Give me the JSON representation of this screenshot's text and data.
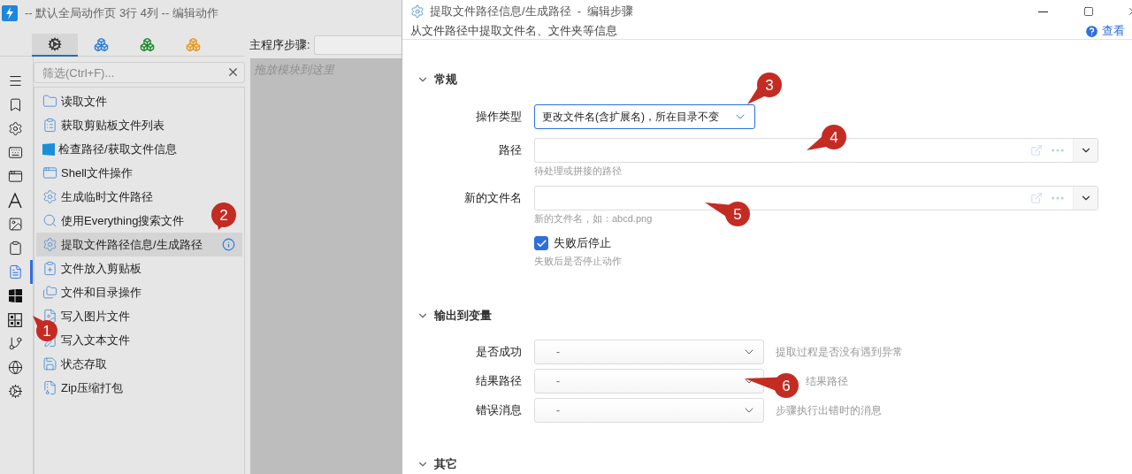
{
  "window": {
    "title": "-- 默认全局动作页 3行 4列 -- 编辑动作"
  },
  "category_tabs": [
    {
      "selected": true,
      "color": "#333333"
    },
    {
      "selected": false,
      "color": "#2f80d8"
    },
    {
      "selected": false,
      "color": "#1f8a2e"
    },
    {
      "selected": false,
      "color": "#e8981c"
    }
  ],
  "filter": {
    "placeholder": "筛选(Ctrl+F)..."
  },
  "rail": [
    {
      "selected": false
    },
    {
      "selected": false
    },
    {
      "selected": false
    },
    {
      "selected": false
    },
    {
      "selected": false
    },
    {
      "selected": false
    },
    {
      "selected": false
    },
    {
      "selected": false
    },
    {
      "selected": true
    },
    {
      "selected": false
    },
    {
      "selected": false
    },
    {
      "selected": false
    },
    {
      "selected": false
    },
    {
      "selected": false
    }
  ],
  "modules": [
    {
      "label": "读取文件",
      "selected": false
    },
    {
      "label": "获取剪贴板文件列表",
      "selected": false
    },
    {
      "label": "检查路径/获取文件信息",
      "selected": false
    },
    {
      "label": "Shell文件操作",
      "selected": false
    },
    {
      "label": "生成临时文件路径",
      "selected": false
    },
    {
      "label": "使用Everything搜索文件",
      "selected": false
    },
    {
      "label": "提取文件路径信息/生成路径",
      "selected": true
    },
    {
      "label": "文件放入剪贴板",
      "selected": false
    },
    {
      "label": "文件和目录操作",
      "selected": false
    },
    {
      "label": "写入图片文件",
      "selected": false
    },
    {
      "label": "写入文本文件",
      "selected": false
    },
    {
      "label": "状态存取",
      "selected": false
    },
    {
      "label": "Zip压缩打包",
      "selected": false
    }
  ],
  "main_steps": {
    "label": "主程序步骤:"
  },
  "drop_hint": "拖放模块到这里",
  "dialog": {
    "title": "提取文件路径信息/生成路径  -  编辑步骤",
    "subtitle": "从文件路径中提取文件名、文件夹等信息",
    "help_link": "查看",
    "sections": [
      {
        "title": "常规",
        "expanded": true,
        "fields": [
          {
            "kind": "select",
            "label": "操作类型",
            "value": "更改文件名(含扩展名)，所在目录不变",
            "focused": true
          },
          {
            "kind": "path",
            "label": "路径",
            "hint": "待处理或拼接的路径"
          },
          {
            "kind": "path",
            "label": "新的文件名",
            "hint": "新的文件名，如：abcd.png"
          },
          {
            "kind": "checkbox",
            "label": "失败后停止",
            "checked": true,
            "hint": "失败后是否停止动作"
          }
        ]
      },
      {
        "title": "输出到变量",
        "expanded": true,
        "fields": [
          {
            "kind": "output",
            "label": "是否成功",
            "value": "-",
            "hint": "提取过程是否没有遇到异常"
          },
          {
            "kind": "output",
            "label": "结果路径",
            "value": "-",
            "hint": "结果路径"
          },
          {
            "kind": "output",
            "label": "错误消息",
            "value": "-",
            "hint": "步骤执行出错时的消息"
          }
        ]
      },
      {
        "title": "其它",
        "expanded": true
      }
    ]
  },
  "callouts": [
    {
      "number": "1"
    },
    {
      "number": "2"
    },
    {
      "number": "3"
    },
    {
      "number": "4"
    },
    {
      "number": "5"
    },
    {
      "number": "6"
    }
  ]
}
